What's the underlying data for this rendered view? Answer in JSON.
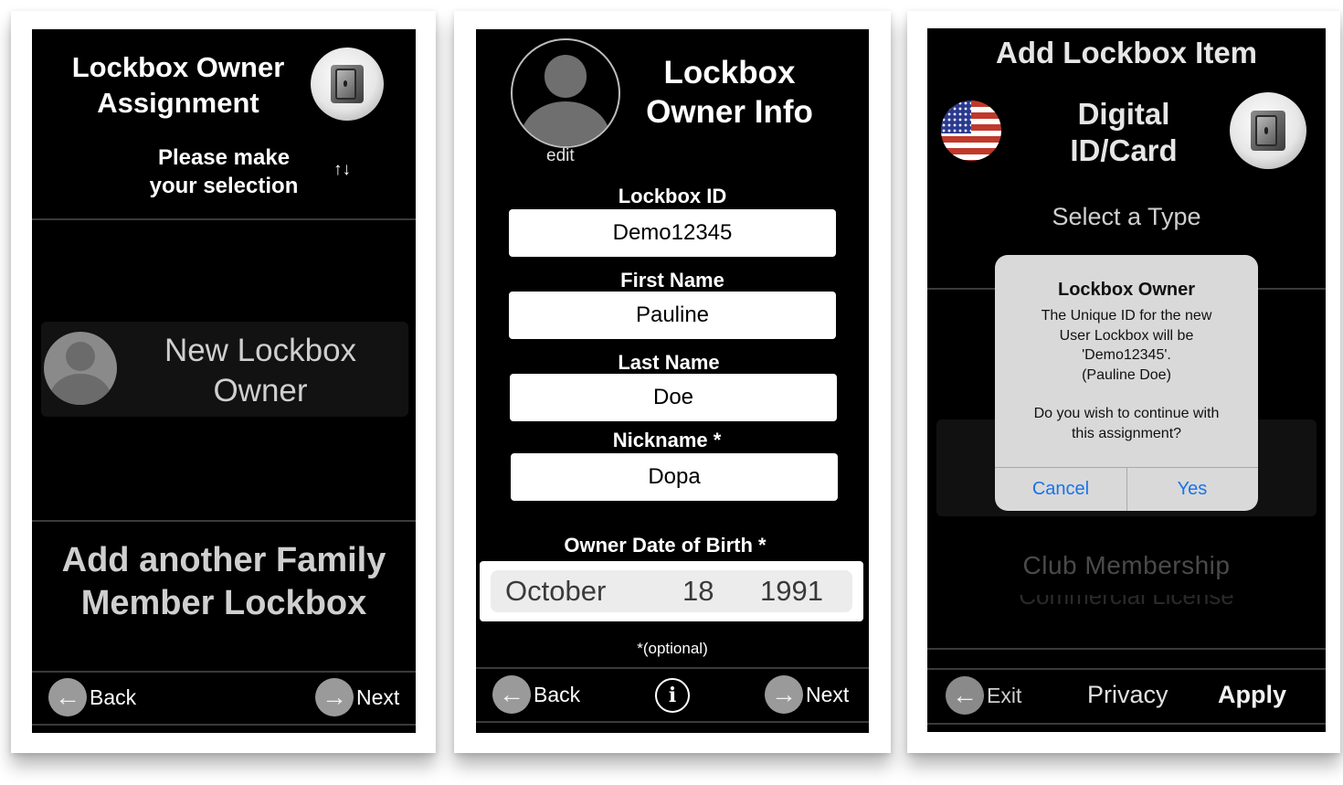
{
  "screen1": {
    "title_line1": "Lockbox Owner",
    "title_line2": "Assignment",
    "subtitle_line1": "Please make",
    "subtitle_line2": "your selection",
    "sort_glyph": "↑↓",
    "option_line1": "New Lockbox",
    "option_line2": "Owner",
    "add_another_line1": "Add another Family",
    "add_another_line2": "Member Lockbox",
    "back_label": "Back",
    "next_label": "Next"
  },
  "screen2": {
    "title_line1": "Lockbox",
    "title_line2": "Owner Info",
    "edit_label": "edit",
    "lockbox_id_label": "Lockbox ID",
    "lockbox_id_value": "Demo12345",
    "first_name_label": "First Name",
    "first_name_value": "Pauline",
    "last_name_label": "Last Name",
    "last_name_value": "Doe",
    "nickname_label": "Nickname *",
    "nickname_value": "Dopa",
    "dob_label": "Owner Date of Birth *",
    "dob_month": "October",
    "dob_day": "18",
    "dob_year": "1991",
    "optional_note": "*(optional)",
    "back_label": "Back",
    "info_glyph": "i",
    "next_label": "Next"
  },
  "screen3": {
    "header": "Add Lockbox Item",
    "category_line1": "Digital",
    "category_line2": "ID/Card",
    "select_type": "Select a Type",
    "dialog": {
      "title": "Lockbox Owner",
      "message_line1": "The Unique ID for the new",
      "message_line2": "User Lockbox will be",
      "message_line3": "'Demo12345'.",
      "message_line4": "(Pauline Doe)",
      "question_line1": "Do you wish to continue with",
      "question_line2": "this assignment?",
      "cancel_label": "Cancel",
      "yes_label": "Yes"
    },
    "picker_item": "Club Membership",
    "picker_item_faded": "Commercial License",
    "exit_label": "Exit",
    "privacy_label": "Privacy",
    "apply_label": "Apply"
  },
  "colors": {
    "screen_bg": "#000000",
    "ios_blue": "#1a73e8",
    "nav_circle": "#9a9a9a",
    "dialog_bg": "#d9d9d9"
  }
}
